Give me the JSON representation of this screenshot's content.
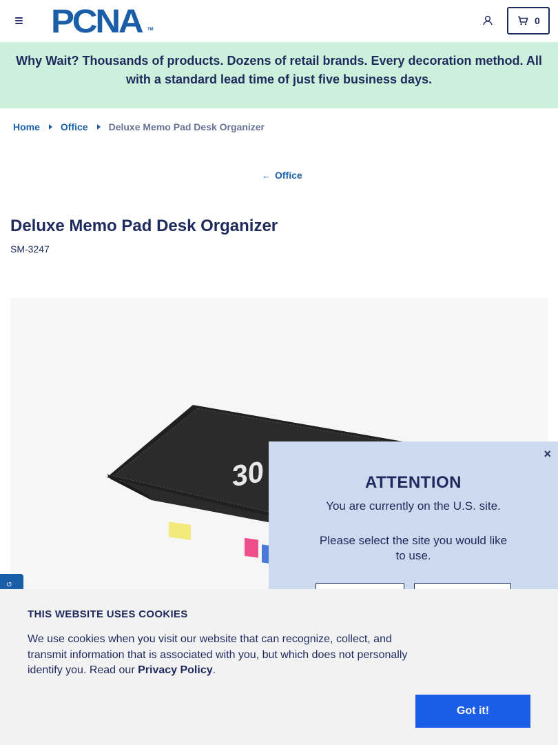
{
  "header": {
    "logo_text": "PCNA",
    "logo_tm": "TM",
    "cart_count": "0"
  },
  "banner": {
    "text": "Why Wait? Thousands of products. Dozens of retail brands. Every decoration method. All with a standard lead time of just five business days."
  },
  "breadcrumb": {
    "items": [
      "Home",
      "Office"
    ],
    "current": "Deluxe Memo Pad Desk Organizer"
  },
  "back_link": {
    "arrow": "←",
    "label": "Office"
  },
  "product": {
    "title": "Deluxe Memo Pad Desk Organizer",
    "sku": "SM-3247",
    "image_print": "30"
  },
  "side_tab": {
    "label": "G"
  },
  "modal": {
    "close": "×",
    "title": "ATTENTION",
    "line1": "You are currently on the U.S. site.",
    "line2": "Please select the site you would like to use."
  },
  "cookie": {
    "title": "THIS WEBSITE USES COOKIES",
    "text_before": "We use cookies when you visit our website that can recognize, collect, and transmit information that is associated with you, but which does not personally identify you. Read our ",
    "link": "Privacy Policy",
    "text_after": ".",
    "button": "Got it!"
  },
  "colors": {
    "brand_blue": "#1a5ea8",
    "navy": "#1f2a5c",
    "banner_green": "#cdf0dc",
    "modal_blue": "#cdd9ef",
    "cookie_button": "#1a5ee8"
  },
  "icons": [
    "menu-icon",
    "account-icon",
    "cart-icon",
    "back-arrow-icon",
    "close-icon"
  ]
}
